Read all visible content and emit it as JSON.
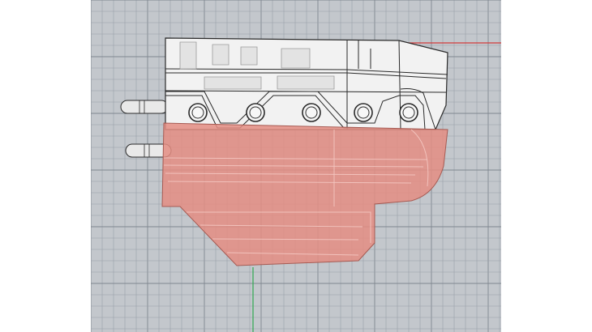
{
  "app": {
    "view_kind": "3D modeling viewport (shaded/x-ray)"
  },
  "viewport": {
    "background_color": "#c3c7cc",
    "grid_minor_color": "#99a0a8",
    "grid_major_color": "#7f8790",
    "x_axis_color": "#d23b3b",
    "y_axis_color": "#2fa84f"
  },
  "model": {
    "upper_part": {
      "fill": "#f2f2f2",
      "stroke": "#2a2a2a",
      "description_hidden": true
    },
    "lower_part": {
      "fill": "#e48d82",
      "opacity": 0.85,
      "stroke": "#a65a52"
    },
    "rod_fill": "#e9e9e9",
    "rod_stroke": "#2a2a2a",
    "hole_count": 5
  },
  "icons": {
    "x_axis": "x-axis-line",
    "y_axis": "y-axis-line"
  }
}
